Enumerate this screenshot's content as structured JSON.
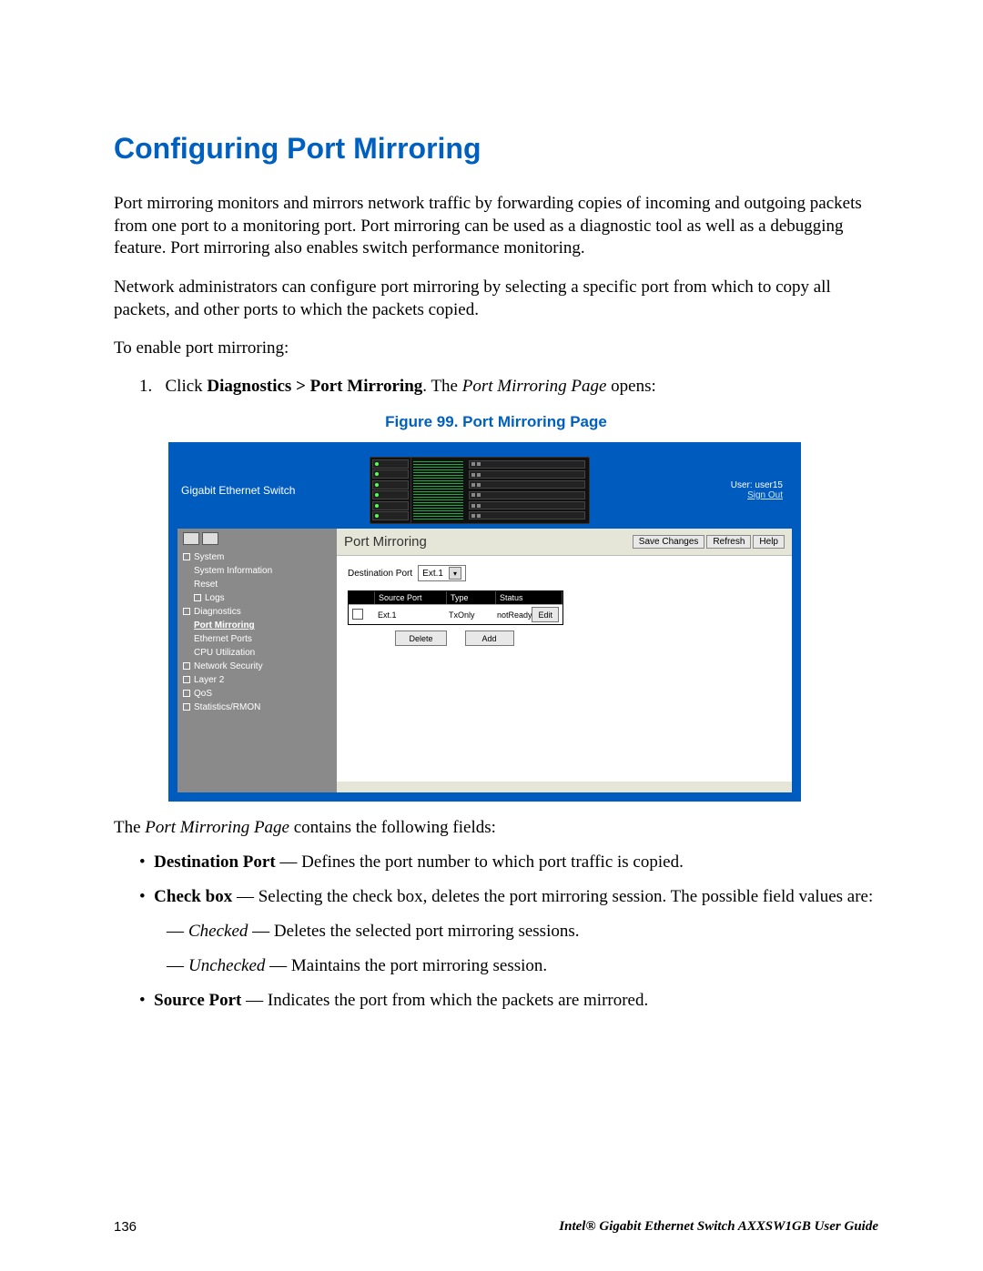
{
  "title": "Configuring Port Mirroring",
  "para1": "Port mirroring monitors and mirrors network traffic by forwarding copies of incoming and outgoing packets from one port to a monitoring port. Port mirroring can be used as a diagnostic tool as well as a debugging feature. Port mirroring also enables switch performance monitoring.",
  "para2": "Network administrators can configure port mirroring by selecting a specific port from which to copy all packets, and other ports to which the packets copied.",
  "para3": "To enable port mirroring:",
  "step1_pre": "Click ",
  "step1_bold": "Diagnostics > Port Mirroring",
  "step1_mid": ". The ",
  "step1_ital": "Port Mirroring Page",
  "step1_post": " opens:",
  "fig_caption": "Figure 99. Port Mirroring Page",
  "shot": {
    "brand": "Gigabit Ethernet Switch",
    "user_label": "User: user15",
    "signout": "Sign Out",
    "nav": {
      "items": [
        {
          "txt": "System",
          "lvl": "lvl1",
          "sq": true
        },
        {
          "txt": "System Information",
          "lvl": "lvl2"
        },
        {
          "txt": "Reset",
          "lvl": "lvl2"
        },
        {
          "txt": "Logs",
          "lvl": "lvl2",
          "sq": true
        },
        {
          "txt": "Diagnostics",
          "lvl": "lvl1",
          "sq": true
        },
        {
          "txt": "Port Mirroring",
          "lvl": "lvl2",
          "sel": true
        },
        {
          "txt": "Ethernet Ports",
          "lvl": "lvl2"
        },
        {
          "txt": "CPU Utilization",
          "lvl": "lvl2"
        },
        {
          "txt": "Network Security",
          "lvl": "lvl1",
          "sq": true
        },
        {
          "txt": "Layer 2",
          "lvl": "lvl1",
          "sq": true
        },
        {
          "txt": "QoS",
          "lvl": "lvl1",
          "sq": true
        },
        {
          "txt": "Statistics/RMON",
          "lvl": "lvl1",
          "sq": true
        }
      ]
    },
    "page_title": "Port Mirroring",
    "btn_save": "Save Changes",
    "btn_refresh": "Refresh",
    "btn_help": "Help",
    "dest_label": "Destination Port",
    "dest_value": "Ext.1",
    "th_chk": " ",
    "th_src": "Source Port",
    "th_type": "Type",
    "th_status": "Status",
    "row_port": "Ext.1",
    "row_type": "TxOnly",
    "row_status": "notReady",
    "btn_edit": "Edit",
    "btn_delete": "Delete",
    "btn_add": "Add"
  },
  "after1_pre": "The ",
  "after1_ital": "Port Mirroring Page",
  "after1_post": " contains the following fields:",
  "bullet_dp_b": "Destination Port",
  "bullet_dp_t": " — Defines the port number to which port traffic is copied.",
  "bullet_cb_b": "Check box",
  "bullet_cb_t": " — Selecting the check box, deletes the port mirroring session. The possible field values are:",
  "sub_checked_i": "Checked",
  "sub_checked_t": " — Deletes the selected port mirroring sessions.",
  "sub_unchecked_i": "Unchecked",
  "sub_unchecked_t": " — Maintains the port mirroring session.",
  "bullet_sp_b": "Source Port",
  "bullet_sp_t": " — Indicates the port from which the packets are mirrored.",
  "page_number": "136",
  "guide_title": "Intel® Gigabit Ethernet Switch AXXSW1GB User Guide"
}
